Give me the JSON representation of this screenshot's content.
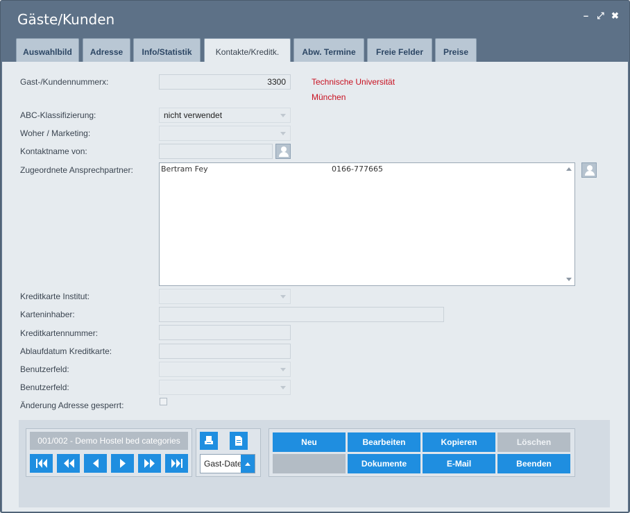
{
  "window": {
    "title": "Gäste/Kunden",
    "controls": [
      "minimize-icon",
      "restore-icon",
      "close-icon"
    ]
  },
  "tabs": [
    {
      "label": "Auswahlbild",
      "active": false
    },
    {
      "label": "Adresse",
      "active": false
    },
    {
      "label": "Info/Statistik",
      "active": false
    },
    {
      "label": "Kontakte/Kreditk.",
      "active": true
    },
    {
      "label": "Abw. Termine",
      "active": false
    },
    {
      "label": "Freie Felder",
      "active": false
    },
    {
      "label": "Preise",
      "active": false
    }
  ],
  "form": {
    "customer_number": {
      "label": "Gast-/Kundennummerx:",
      "value": "3300"
    },
    "customer_name_line1": "Technische Universität",
    "customer_name_line2": "München",
    "abc": {
      "label": "ABC-Klassifizierung:",
      "value": "nicht verwendet"
    },
    "marketing": {
      "label": "Woher / Marketing:",
      "value": ""
    },
    "contact_name": {
      "label": "Kontaktname von:",
      "value": ""
    },
    "contacts": {
      "label": "Zugeordnete Ansprechpartner:",
      "rows": [
        {
          "name": "Bertram  Fey",
          "phone": "0166-777665"
        }
      ]
    },
    "cc_institute": {
      "label": "Kreditkarte Institut:",
      "value": ""
    },
    "card_holder": {
      "label": "Karteninhaber:",
      "value": ""
    },
    "cc_number": {
      "label": "Kreditkartennummer:",
      "value": ""
    },
    "cc_expiry": {
      "label": "Ablaufdatum Kreditkarte:",
      "value": ""
    },
    "user_field_1": {
      "label": "Benutzerfeld:",
      "value": ""
    },
    "user_field_2": {
      "label": "Benutzerfeld:",
      "value": ""
    },
    "address_locked": {
      "label": "Änderung Adresse gesperrt:",
      "checked": false
    }
  },
  "footer": {
    "record_info": "001/002 - Demo Hostel bed categories",
    "nav_icons": [
      "first-icon",
      "fast-back-icon",
      "prev-icon",
      "next-icon",
      "fast-forward-icon",
      "last-icon"
    ],
    "report_select": "Gast-Date",
    "buttons": {
      "new": "Neu",
      "edit": "Bearbeiten",
      "copy": "Kopieren",
      "delete": "Löschen",
      "documents": "Dokumente",
      "email": "E-Mail",
      "close": "Beenden"
    }
  },
  "colors": {
    "titlebar": "#5d7187",
    "accent_button": "#1f8ee0",
    "disabled_button": "#b3bcc5",
    "customer_name": "#c81020"
  }
}
